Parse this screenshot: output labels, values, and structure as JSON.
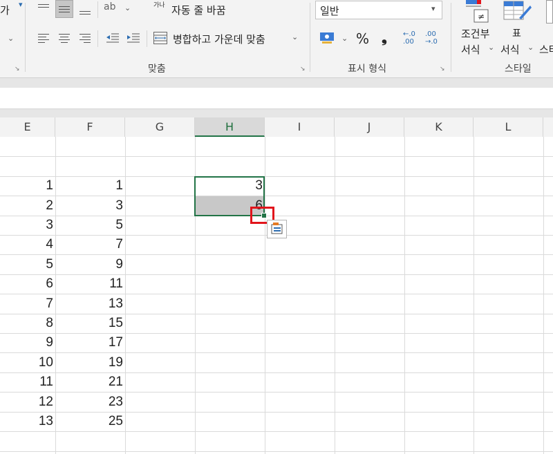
{
  "ribbon": {
    "ga_fragment": "가",
    "orientation_glyph": "ab",
    "wrap_text_glyph": "가나",
    "wrap_text_label": "자동 줄 바꿈",
    "merge_center_label": "병합하고 가운데 맞춤",
    "alignment_group": "맞춤",
    "number_format_value": "일반",
    "percent_label": "%",
    "comma_label": "❟",
    "increase_decimal_label": "←.0 .00",
    "decrease_decimal_label": ".00 →.0",
    "number_group": "표시 형식",
    "conditional_format_line1": "조건부",
    "conditional_format_line2": "서식",
    "format_table_line1": "표",
    "format_table_line2": "서식",
    "cell_styles_fragment": "스타",
    "styles_group": "스타일",
    "not_equal_glyph": "≠"
  },
  "columns": [
    "E",
    "F",
    "G",
    "H",
    "I",
    "J",
    "K",
    "L"
  ],
  "selected_column": "H",
  "column_e": [
    "1",
    "2",
    "3",
    "4",
    "5",
    "6",
    "7",
    "8",
    "9",
    "10",
    "11",
    "12",
    "13"
  ],
  "column_f": [
    "1",
    "3",
    "5",
    "7",
    "9",
    "11",
    "13",
    "15",
    "17",
    "19",
    "21",
    "23",
    "25"
  ],
  "column_h": [
    "3",
    "6"
  ],
  "colors": {
    "selection": "#217346",
    "highlight_box": "#e1141b",
    "ribbon_bg": "#f3f3f3"
  },
  "icons": [
    "align-top-icon",
    "align-middle-icon",
    "align-bottom-icon",
    "orientation-icon",
    "wrap-text-icon",
    "align-left-icon",
    "align-center-icon",
    "align-right-icon",
    "decrease-indent-icon",
    "increase-indent-icon",
    "merge-center-icon",
    "currency-icon",
    "conditional-format-icon",
    "format-table-icon",
    "autofill-options-icon"
  ]
}
